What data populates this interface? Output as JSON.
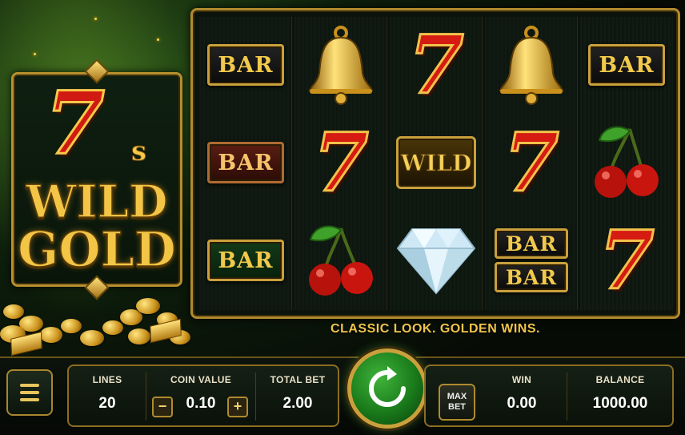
{
  "logo": {
    "seven": "7",
    "s": "s",
    "line1": "WILD",
    "line2": "GOLD"
  },
  "tagline": "CLASSIC LOOK. GOLDEN WINS.",
  "reels": [
    [
      "bar-gold",
      "seven-dummy",
      "bar-green"
    ],
    [
      "bell",
      "seven",
      "cherry"
    ],
    [
      "seven",
      "wild",
      "diamond"
    ],
    [
      "bell",
      "seven",
      "double-bar"
    ],
    [
      "bar-gold",
      "cherry",
      "seven"
    ]
  ],
  "symbols": {
    "bar": "BAR",
    "seven": "7",
    "wild": "WILD"
  },
  "controls": {
    "menu_icon": "hamburger-menu-icon",
    "lines_label": "LINES",
    "lines_value": "20",
    "coin_label": "COIN VALUE",
    "coin_minus": "−",
    "coin_value": "0.10",
    "coin_plus": "+",
    "total_bet_label": "TOTAL BET",
    "total_bet_value": "2.00",
    "spin_icon": "spin-arrow-icon",
    "maxbet_line1": "MAX",
    "maxbet_line2": "BET",
    "win_label": "WIN",
    "win_value": "0.00",
    "balance_label": "BALANCE",
    "balance_value": "1000.00"
  },
  "colors": {
    "gold": "#f1c44c",
    "red_seven": "#d51b12",
    "spin_green": "#197a1a"
  }
}
